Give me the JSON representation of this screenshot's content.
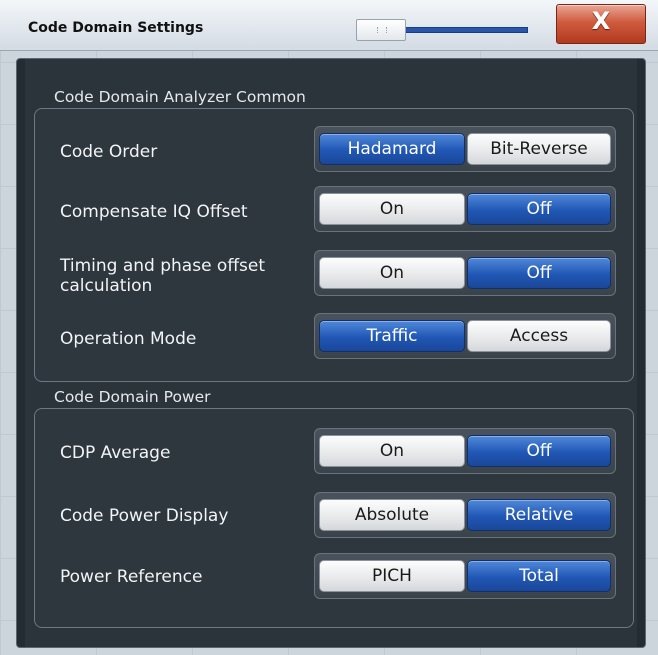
{
  "window": {
    "title": "Code Domain Settings",
    "close_label": "X"
  },
  "groups": {
    "common": {
      "title": "Code Domain Analyzer Common"
    },
    "power": {
      "title": "Code Domain Power"
    }
  },
  "rows": {
    "code_order": {
      "label": "Code Order",
      "left": "Hadamard",
      "right": "Bit-Reverse",
      "selected": "Hadamard"
    },
    "compensate_iq": {
      "label": "Compensate IQ Offset",
      "left": "On",
      "right": "Off",
      "selected": "Off"
    },
    "timing_phase": {
      "label": "Timing and phase offset calculation",
      "line1": "Timing and phase offset",
      "line2": "calculation",
      "left": "On",
      "right": "Off",
      "selected": "Off"
    },
    "operation_mode": {
      "label": "Operation Mode",
      "left": "Traffic",
      "right": "Access",
      "selected": "Traffic"
    },
    "cdp_average": {
      "label": "CDP Average",
      "left": "On",
      "right": "Off",
      "selected": "Off"
    },
    "code_power_display": {
      "label": "Code Power Display",
      "left": "Absolute",
      "right": "Relative",
      "selected": "Relative"
    },
    "power_reference": {
      "label": "Power Reference",
      "left": "PICH",
      "right": "Total",
      "selected": "Total"
    }
  },
  "colors": {
    "selected": "#2157b5",
    "dialog_bg": "#2b333b",
    "close": "#cf5b3e"
  }
}
